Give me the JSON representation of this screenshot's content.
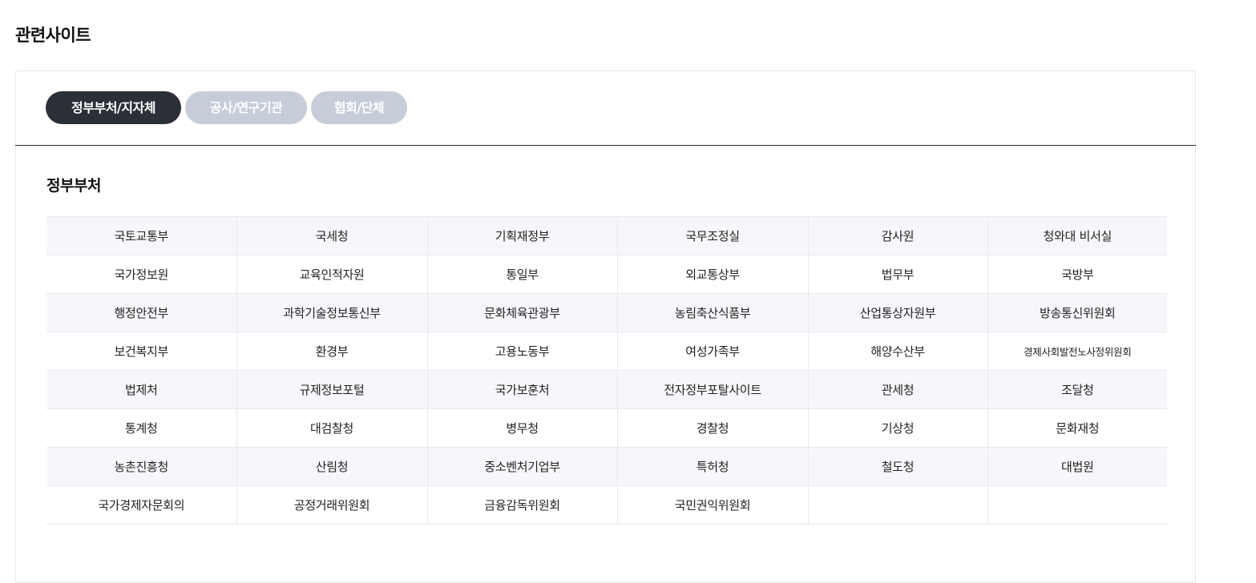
{
  "page": {
    "title": "관련사이트"
  },
  "tabs": [
    {
      "label": "정부부처/지자체",
      "active": true
    },
    {
      "label": "공사/연구기관",
      "active": false
    },
    {
      "label": "협회/단체",
      "active": false
    }
  ],
  "section": {
    "title": "정부부처"
  },
  "rows": [
    [
      "국토교통부",
      "국세청",
      "기획재정부",
      "국무조정실",
      "감사원",
      "청와대 비서실"
    ],
    [
      "국가정보원",
      "교육인적자원",
      "통일부",
      "외교통상부",
      "법무부",
      "국방부"
    ],
    [
      "행정안전부",
      "과학기술정보통신부",
      "문화체육관광부",
      "농림축산식품부",
      "산업통상자원부",
      "방송통신위원회"
    ],
    [
      "보건복지부",
      "환경부",
      "고용노동부",
      "여성가족부",
      "해양수산부",
      "경제사회발전노사정위원회"
    ],
    [
      "법제처",
      "규제정보포털",
      "국가보훈처",
      "전자정부포탈사이트",
      "관세청",
      "조달청"
    ],
    [
      "통계청",
      "대검찰청",
      "병무청",
      "경찰청",
      "기상청",
      "문화재청"
    ],
    [
      "농촌진흥청",
      "산림청",
      "중소벤처기업부",
      "특허청",
      "철도청",
      "대법원"
    ],
    [
      "국가경제자문회의",
      "공정거래위원회",
      "금융감독위원회",
      "국민권익위원회",
      "",
      ""
    ]
  ],
  "colors": {
    "tab_active_bg": "#2b2f38",
    "tab_inactive_bg": "#c6ccd8",
    "row_alt_bg": "#f7f7fb"
  }
}
